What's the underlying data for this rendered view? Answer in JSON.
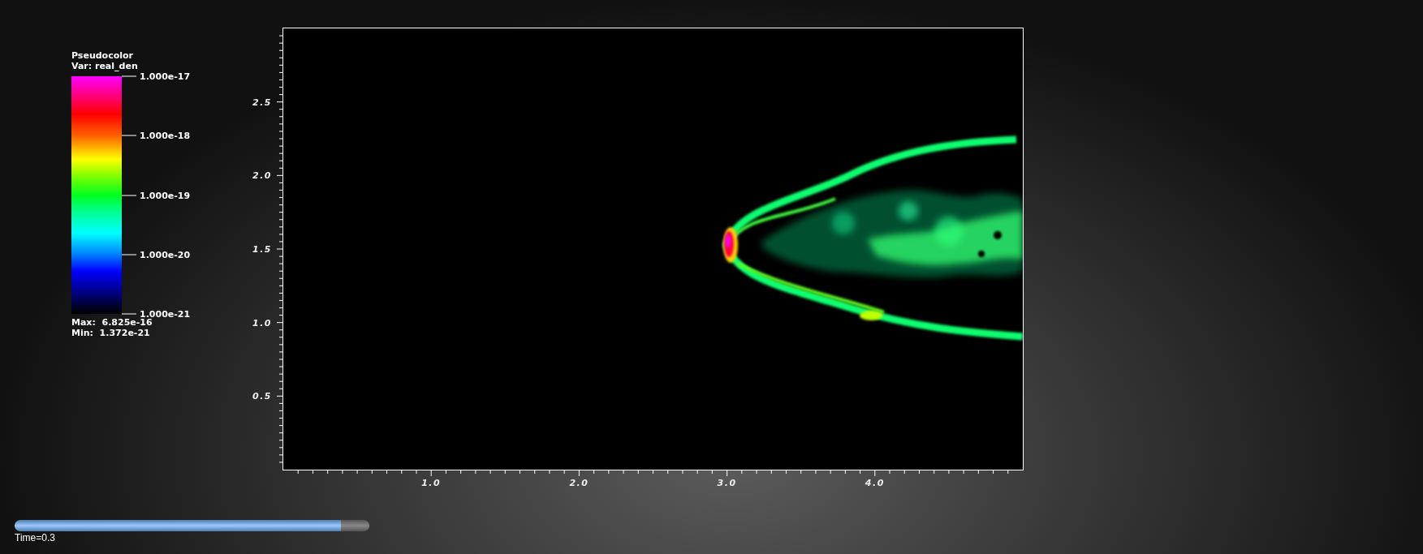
{
  "legend": {
    "title": "Pseudocolor",
    "variable": "Var: real_den",
    "scale_labels": [
      "1.000e-17",
      "1.000e-18",
      "1.000e-19",
      "1.000e-20",
      "1.000e-21"
    ],
    "max": "Max:  6.825e-16",
    "min": "Min:  1.372e-21"
  },
  "plot": {
    "y_ticks": [
      "2.5",
      "2.0",
      "1.5",
      "1.0",
      "0.5"
    ],
    "x_ticks": [
      "1.0",
      "2.0",
      "3.0",
      "4.0"
    ]
  },
  "time_slider": {
    "level": 0.92,
    "label": "Time=0.3"
  }
}
